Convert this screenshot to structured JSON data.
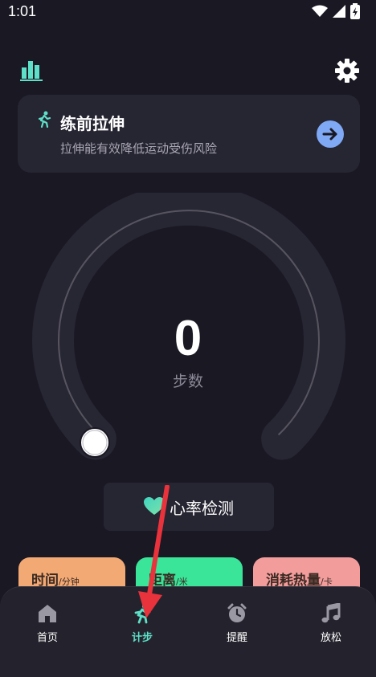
{
  "status_bar": {
    "time": "1:01"
  },
  "stretch_card": {
    "title": "练前拉伸",
    "subtitle": "拉伸能有效降低运动受伤风险"
  },
  "step_gauge": {
    "count": "0",
    "label": "步数"
  },
  "heart_rate_button": {
    "label": "心率检测"
  },
  "metrics": [
    {
      "name": "时间",
      "unit": "/分钟"
    },
    {
      "name": "距离",
      "unit": "/米"
    },
    {
      "name": "消耗热量",
      "unit": "/卡"
    }
  ],
  "bottom_nav": [
    {
      "label": "首页",
      "icon": "home-icon"
    },
    {
      "label": "计步",
      "icon": "runner-icon",
      "active": true
    },
    {
      "label": "提醒",
      "icon": "alarm-clock-icon"
    },
    {
      "label": "放松",
      "icon": "music-note-icon"
    }
  ],
  "colors": {
    "background": "#1a1823",
    "card": "#262532",
    "accent_teal": "#5ee0c8",
    "arrow_blue": "#7fa8f5",
    "metric_time": "#f3a974",
    "metric_distance": "#3ae59a",
    "metric_calories": "#f39c9c",
    "annotation_red": "#e8323c"
  }
}
